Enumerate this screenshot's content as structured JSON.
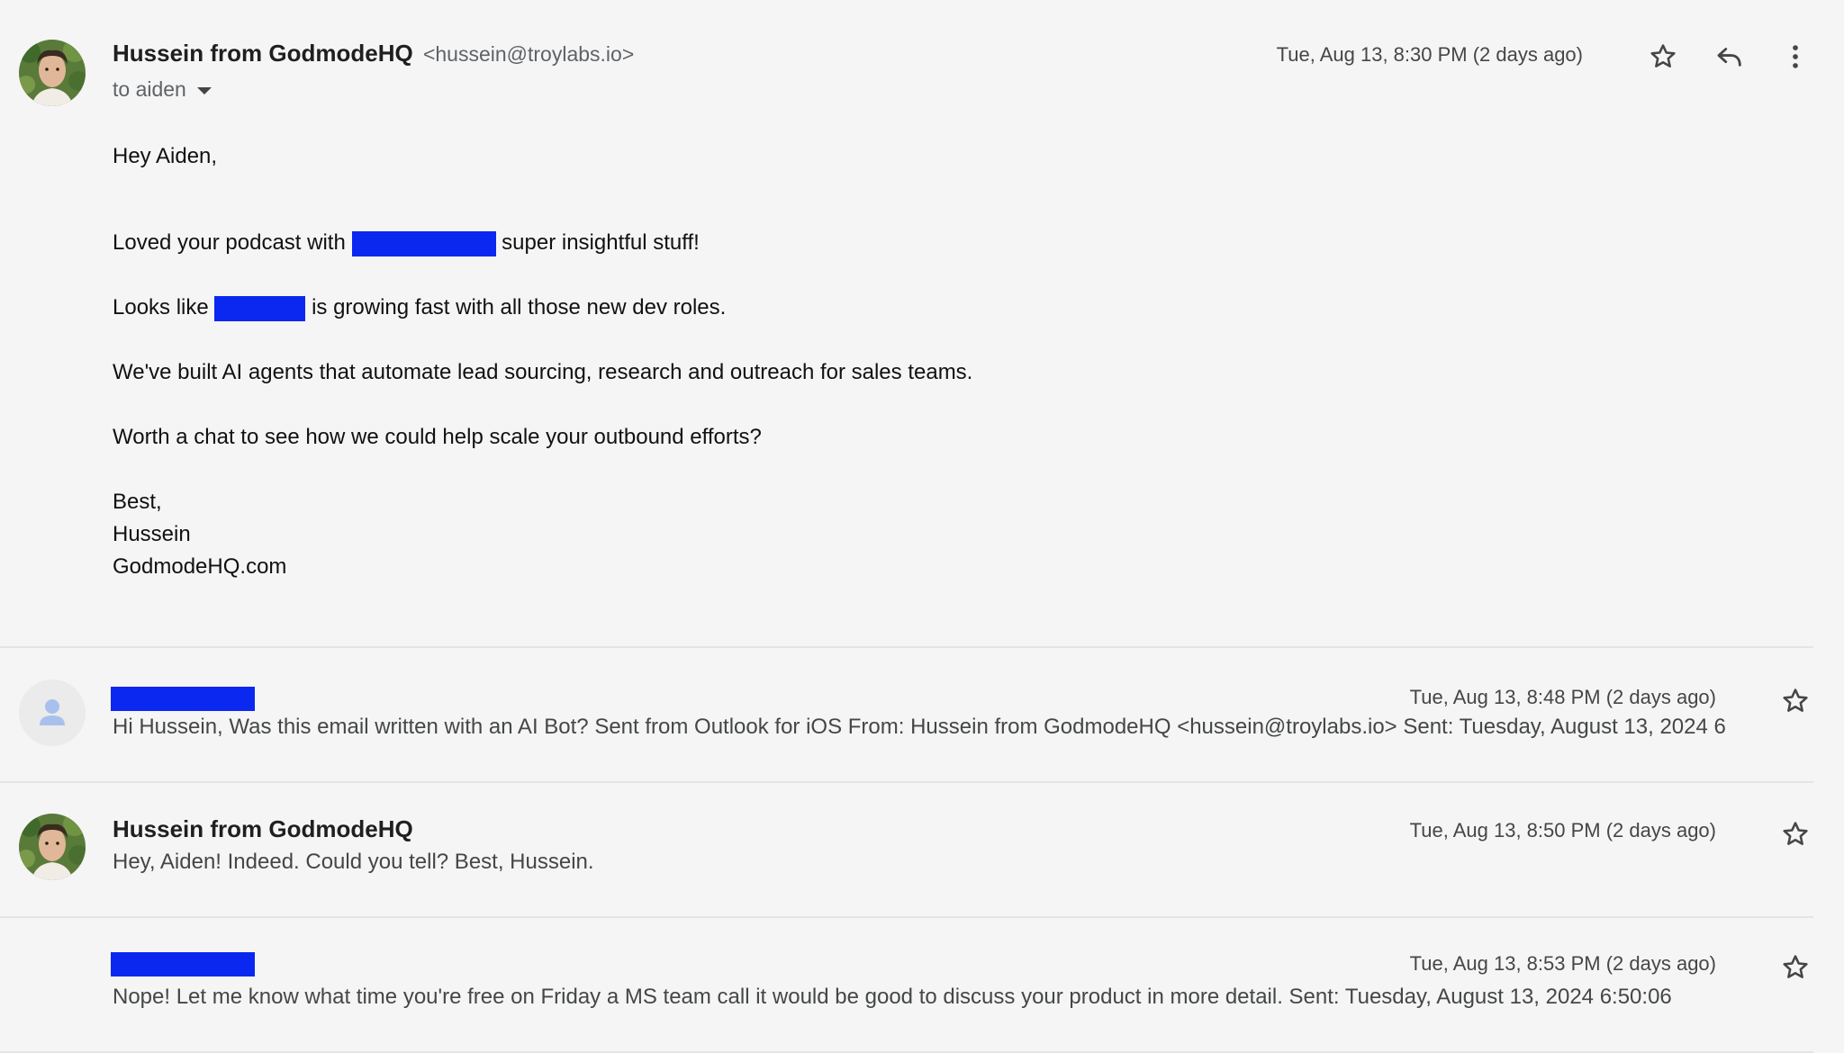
{
  "messages": [
    {
      "sender_name": "Hussein from GodmodeHQ",
      "sender_email": "<hussein@troylabs.io>",
      "to_label": "to aiden",
      "date": "Tue, Aug 13, 8:30 PM (2 days ago)",
      "body": {
        "greeting": "Hey Aiden,",
        "line1_before": "Loved your podcast with",
        "line1_after": "super insightful stuff!",
        "line2_before": "Looks like",
        "line2_after": "is growing fast with all those new dev roles.",
        "line3": "We've built AI agents that automate lead sourcing, research and outreach for sales teams.",
        "line4": "Worth a chat to see how we could help scale your outbound efforts?",
        "signoff": "Best,",
        "signature_name": "Hussein",
        "signature_site": "GodmodeHQ.com"
      }
    },
    {
      "date": "Tue, Aug 13, 8:48 PM (2 days ago)",
      "snippet": "Hi Hussein, Was this email written with an AI Bot? Sent from Outlook for iOS From: Hussein from GodmodeHQ <hussein@troylabs.io> Sent: Tuesday, August 13, 2024 6"
    },
    {
      "sender_name": "Hussein from GodmodeHQ",
      "date": "Tue, Aug 13, 8:50 PM (2 days ago)",
      "snippet": "Hey, Aiden! Indeed. Could you tell? Best, Hussein."
    },
    {
      "date": "Tue, Aug 13, 8:53 PM (2 days ago)",
      "snippet": "Nope! Let me know what time you're free on Friday a MS team call it would be good to discuss your product in more detail. Sent: Tuesday, August 13, 2024 6:50:06"
    }
  ],
  "icons": {
    "star": "star-icon",
    "reply": "reply-icon",
    "more": "more-vert-icon",
    "caret": "caret-down-icon",
    "person": "person-icon"
  },
  "colors": {
    "redaction": "#0a28f0",
    "background": "#f5f5f5"
  }
}
